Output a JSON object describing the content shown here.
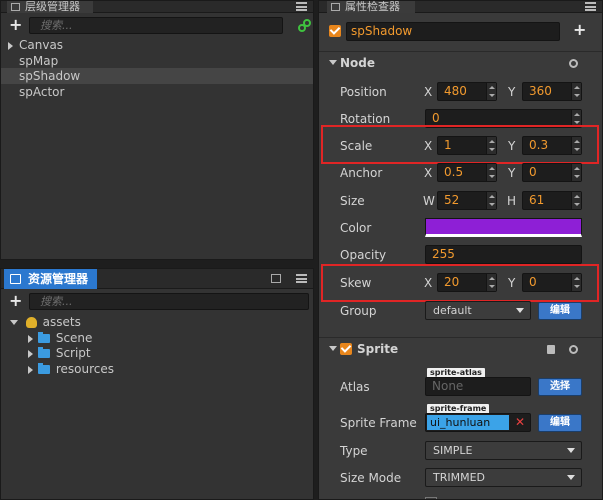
{
  "hierarchy": {
    "tab_title": "层级管理器",
    "search_placeholder": "搜索...",
    "items": [
      "Canvas",
      "spMap",
      "spShadow",
      "spActor"
    ]
  },
  "assets": {
    "tab_title": "资源管理器",
    "search_placeholder": "搜索...",
    "root": "assets",
    "children": [
      "Scene",
      "Script",
      "resources"
    ]
  },
  "inspector": {
    "tab_title": "属性检查器",
    "node_name": "spShadow",
    "node_section": "Node",
    "position": {
      "label": "Position",
      "x_axis": "X",
      "x": "480",
      "y_axis": "Y",
      "y": "360"
    },
    "rotation": {
      "label": "Rotation",
      "value": "0"
    },
    "scale": {
      "label": "Scale",
      "x_axis": "X",
      "x": "1",
      "y_axis": "Y",
      "y": "0.3"
    },
    "anchor": {
      "label": "Anchor",
      "x_axis": "X",
      "x": "0.5",
      "y_axis": "Y",
      "y": "0"
    },
    "size": {
      "label": "Size",
      "w_axis": "W",
      "w": "52",
      "h_axis": "H",
      "h": "61"
    },
    "color": {
      "label": "Color",
      "value": "#8e1fd6"
    },
    "opacity": {
      "label": "Opacity",
      "value": "255"
    },
    "skew": {
      "label": "Skew",
      "x_axis": "X",
      "x": "20",
      "y_axis": "Y",
      "y": "0"
    },
    "group": {
      "label": "Group",
      "value": "default",
      "edit": "编辑"
    },
    "sprite_section": "Sprite",
    "atlas": {
      "label": "Atlas",
      "tag": "sprite-atlas",
      "value": "None",
      "button": "选择"
    },
    "sprite_frame": {
      "label": "Sprite Frame",
      "tag": "sprite-frame",
      "value": "ui_hunluan",
      "button": "编辑"
    },
    "type": {
      "label": "Type",
      "value": "SIMPLE"
    },
    "size_mode": {
      "label": "Size Mode",
      "value": "TRIMMED"
    }
  },
  "colors": {
    "accent_orange": "#f29a2e",
    "highlight_red": "#e02525",
    "button_blue": "#3a77c8"
  }
}
